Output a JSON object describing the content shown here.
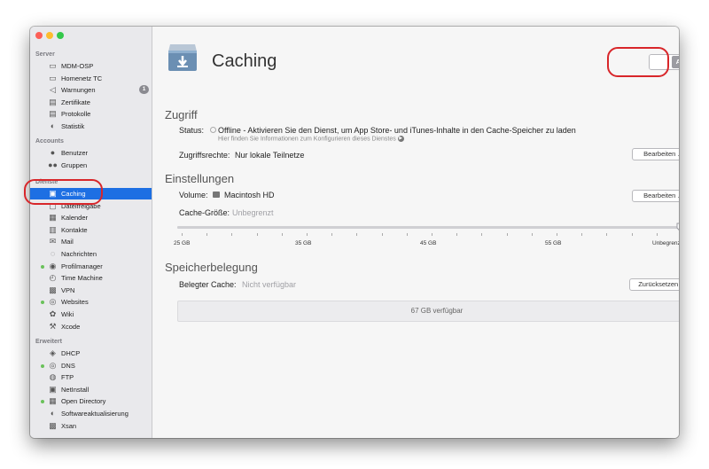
{
  "window": {
    "controls": [
      "close",
      "minimize",
      "zoom"
    ]
  },
  "sidebar": {
    "sections": [
      {
        "title": "Server",
        "items": [
          {
            "label": "MDM-OSP",
            "icon": "server-icon"
          },
          {
            "label": "Homenetz TC",
            "icon": "airport-icon"
          },
          {
            "label": "Warnungen",
            "icon": "megaphone-icon",
            "badge": "1"
          },
          {
            "label": "Zertifikate",
            "icon": "certificate-icon"
          },
          {
            "label": "Protokolle",
            "icon": "log-icon"
          },
          {
            "label": "Statistik",
            "icon": "stats-icon"
          }
        ]
      },
      {
        "title": "Accounts",
        "items": [
          {
            "label": "Benutzer",
            "icon": "user-icon"
          },
          {
            "label": "Gruppen",
            "icon": "group-icon"
          }
        ]
      },
      {
        "title": "Dienste",
        "items": [
          {
            "label": "Caching",
            "icon": "caching-icon",
            "selected": true
          },
          {
            "label": "Dateifreigabe",
            "icon": "filesharing-icon"
          },
          {
            "label": "Kalender",
            "icon": "calendar-icon"
          },
          {
            "label": "Kontakte",
            "icon": "contacts-icon"
          },
          {
            "label": "Mail",
            "icon": "mail-icon"
          },
          {
            "label": "Nachrichten",
            "icon": "messages-icon"
          },
          {
            "label": "Profilmanager",
            "icon": "profilemanager-icon",
            "status": "on"
          },
          {
            "label": "Time Machine",
            "icon": "timemachine-icon"
          },
          {
            "label": "VPN",
            "icon": "vpn-icon"
          },
          {
            "label": "Websites",
            "icon": "websites-icon",
            "status": "on"
          },
          {
            "label": "Wiki",
            "icon": "wiki-icon"
          },
          {
            "label": "Xcode",
            "icon": "xcode-icon"
          }
        ]
      },
      {
        "title": "Erweitert",
        "items": [
          {
            "label": "DHCP",
            "icon": "dhcp-icon"
          },
          {
            "label": "DNS",
            "icon": "dns-icon",
            "status": "on"
          },
          {
            "label": "FTP",
            "icon": "ftp-icon"
          },
          {
            "label": "NetInstall",
            "icon": "netinstall-icon"
          },
          {
            "label": "Open Directory",
            "icon": "opendirectory-icon",
            "status": "on"
          },
          {
            "label": "Softwareaktualisierung",
            "icon": "softwareupdate-icon"
          },
          {
            "label": "Xsan",
            "icon": "xsan-icon"
          }
        ]
      }
    ]
  },
  "service": {
    "title": "Caching",
    "toggle": "AUS"
  },
  "zugriff": {
    "heading": "Zugriff",
    "status_label": "Status:",
    "status_text": "Offline - Aktivieren Sie den Dienst, um App Store- und iTunes-Inhalte in den Cache-Speicher zu laden",
    "hint": "Hier finden Sie Informationen zum Konfigurieren dieses Dienstes",
    "rights_label": "Zugriffsrechte:",
    "rights_value": "Nur lokale Teilnetze",
    "edit_button": "Bearbeiten …"
  },
  "einstellungen": {
    "heading": "Einstellungen",
    "volume_label": "Volume:",
    "volume_value": "Macintosh HD",
    "edit_button": "Bearbeiten …",
    "cache_label": "Cache-Größe:",
    "cache_value": "Unbegrenzt",
    "slider_value": 1.0,
    "slider_labels": [
      "25 GB",
      "35 GB",
      "45 GB",
      "55 GB",
      "Unbegrenzt"
    ]
  },
  "speicher": {
    "heading": "Speicherbelegung",
    "used_label": "Belegter Cache:",
    "used_value": "Nicht verfügbar",
    "reset_button": "Zurücksetzen …",
    "bar_text": "67 GB verfügbar"
  }
}
